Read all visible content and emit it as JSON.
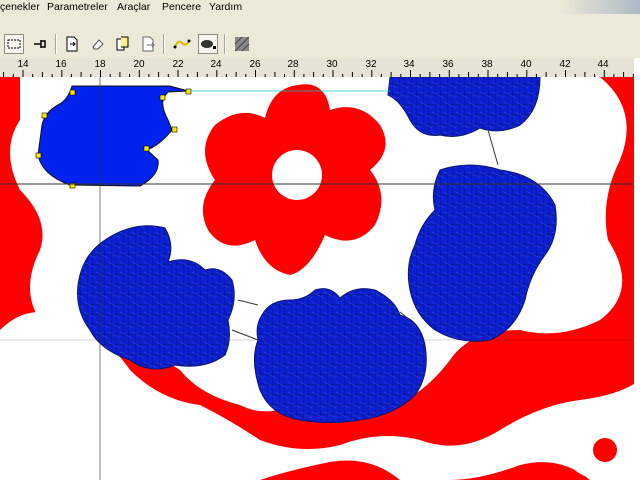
{
  "menu": {
    "items": [
      "çenekler",
      "Parametreler",
      "Araçlar",
      "Pencere",
      "Yardım"
    ]
  },
  "toolbar": {
    "buttons": [
      {
        "icon": "rectangle-select-icon"
      },
      {
        "icon": "pin-icon"
      },
      {
        "icon": "add-page-icon"
      },
      {
        "icon": "eraser-icon"
      },
      {
        "icon": "copy-page-icon"
      },
      {
        "icon": "export-page-icon"
      },
      {
        "icon": "yellow-shape-icon"
      },
      {
        "icon": "ellipse-fill-icon"
      },
      {
        "icon": "fill-pattern-icon"
      }
    ]
  },
  "ruler": {
    "labels": [
      "14",
      "16",
      "18",
      "20",
      "22",
      "24",
      "26",
      "28",
      "30",
      "32",
      "34",
      "36",
      "38",
      "40",
      "42",
      "44"
    ]
  },
  "colors": {
    "background_red": "#ff0000",
    "stitch_blue": "#0022dd",
    "toolbar": "#ece9d8"
  }
}
